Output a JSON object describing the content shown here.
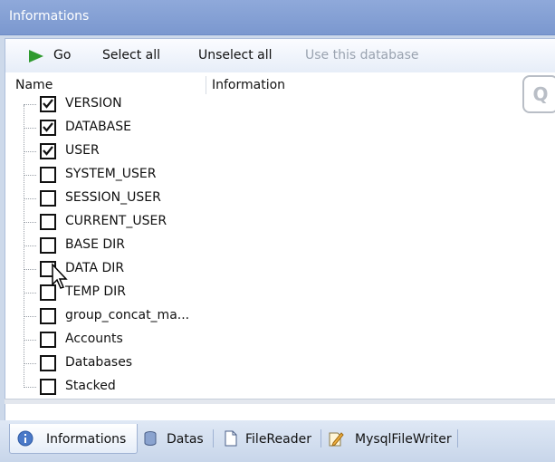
{
  "window": {
    "title": "Informations"
  },
  "toolbar": {
    "go_label": "Go",
    "select_all_label": "Select all",
    "unselect_all_label": "Unselect all",
    "use_db_label": "Use this database"
  },
  "columns": {
    "name": "Name",
    "information": "Information"
  },
  "items": [
    {
      "label": "VERSION",
      "checked": true
    },
    {
      "label": "DATABASE",
      "checked": true
    },
    {
      "label": "USER",
      "checked": true
    },
    {
      "label": "SYSTEM_USER",
      "checked": false
    },
    {
      "label": "SESSION_USER",
      "checked": false
    },
    {
      "label": "CURRENT_USER",
      "checked": false
    },
    {
      "label": "BASE DIR",
      "checked": false
    },
    {
      "label": "DATA DIR",
      "checked": false
    },
    {
      "label": "TEMP DIR",
      "checked": false
    },
    {
      "label": "group_concat_ma...",
      "checked": false
    },
    {
      "label": "Accounts",
      "checked": false
    },
    {
      "label": "Databases",
      "checked": false
    },
    {
      "label": "Stacked",
      "checked": false
    }
  ],
  "tabs": [
    {
      "label": "Informations",
      "icon": "info-icon",
      "active": true
    },
    {
      "label": "Datas",
      "icon": "database-icon",
      "active": false
    },
    {
      "label": "FileReader",
      "icon": "file-icon",
      "active": false
    },
    {
      "label": "MysqlFileWriter",
      "icon": "pencil-file-icon",
      "active": false
    }
  ],
  "colors": {
    "title_bar": "#7b98cf",
    "go_arrow": "#2f9a2f",
    "tab_bar": "#c8d6ea"
  }
}
